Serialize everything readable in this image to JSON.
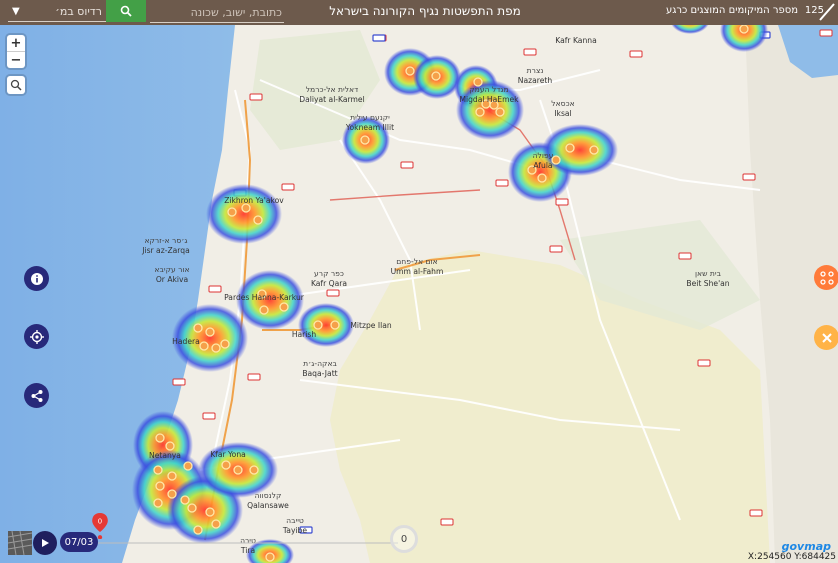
{
  "header": {
    "title": "מפת התפשטות נגיף הקורונה בישראל",
    "search_placeholder": "כתובת, ישוב, שכונה",
    "radius_select": "רדיוס במ׳",
    "count_label": "מספר המיקומים המוצגים כרגע",
    "count_value": "125"
  },
  "timeline": {
    "date": "07/03",
    "pin_value": "0"
  },
  "loader_value": "0",
  "coords": "X:254560 Y:684425",
  "brand": "govmap",
  "colors": {
    "topbar": "#6d5a4c",
    "search": "#43a047",
    "fab": "#27297a",
    "route_orange": "#ff8a34"
  },
  "places": [
    {
      "name": "Nazareth",
      "name_he": "נצרת"
    },
    {
      "name": "Kafr Kanna"
    },
    {
      "name": "Migdal HaEmek",
      "name_he": "מגדל העמק"
    },
    {
      "name": "Iksal",
      "name_he": "אכסאל"
    },
    {
      "name": "Daliyat al-Karmel",
      "name_he": "דאלית אל-כרמל"
    },
    {
      "name": "Yokneam Illit",
      "name_he": "יקנעם עילית"
    },
    {
      "name": "Afula",
      "name_he": "עפולה"
    },
    {
      "name": "Zikhron Ya'akov"
    },
    {
      "name": "Jisr az-Zarqa",
      "name_he": "ג׳סר א-זרקא"
    },
    {
      "name": "Or Akiva",
      "name_he": "אור עקיבא"
    },
    {
      "name": "Kafr Qara",
      "name_he": "כפר קרע"
    },
    {
      "name": "Umm al-Fahm",
      "name_he": "אום אל-פחם"
    },
    {
      "name": "Pardes Hanna-Karkur"
    },
    {
      "name": "Hadera"
    },
    {
      "name": "Harish"
    },
    {
      "name": "Mitzpe Ilan"
    },
    {
      "name": "Baqa-Jatt",
      "name_he": "באקה-ג׳ת"
    },
    {
      "name": "Beit She'an",
      "name_he": "בית שאן"
    },
    {
      "name": "Netanya"
    },
    {
      "name": "Kfar Yona"
    },
    {
      "name": "Qalansawe",
      "name_he": "קלנסווה"
    },
    {
      "name": "Tayibe",
      "name_he": "טייבה"
    },
    {
      "name": "Tira",
      "name_he": "טירה"
    }
  ]
}
